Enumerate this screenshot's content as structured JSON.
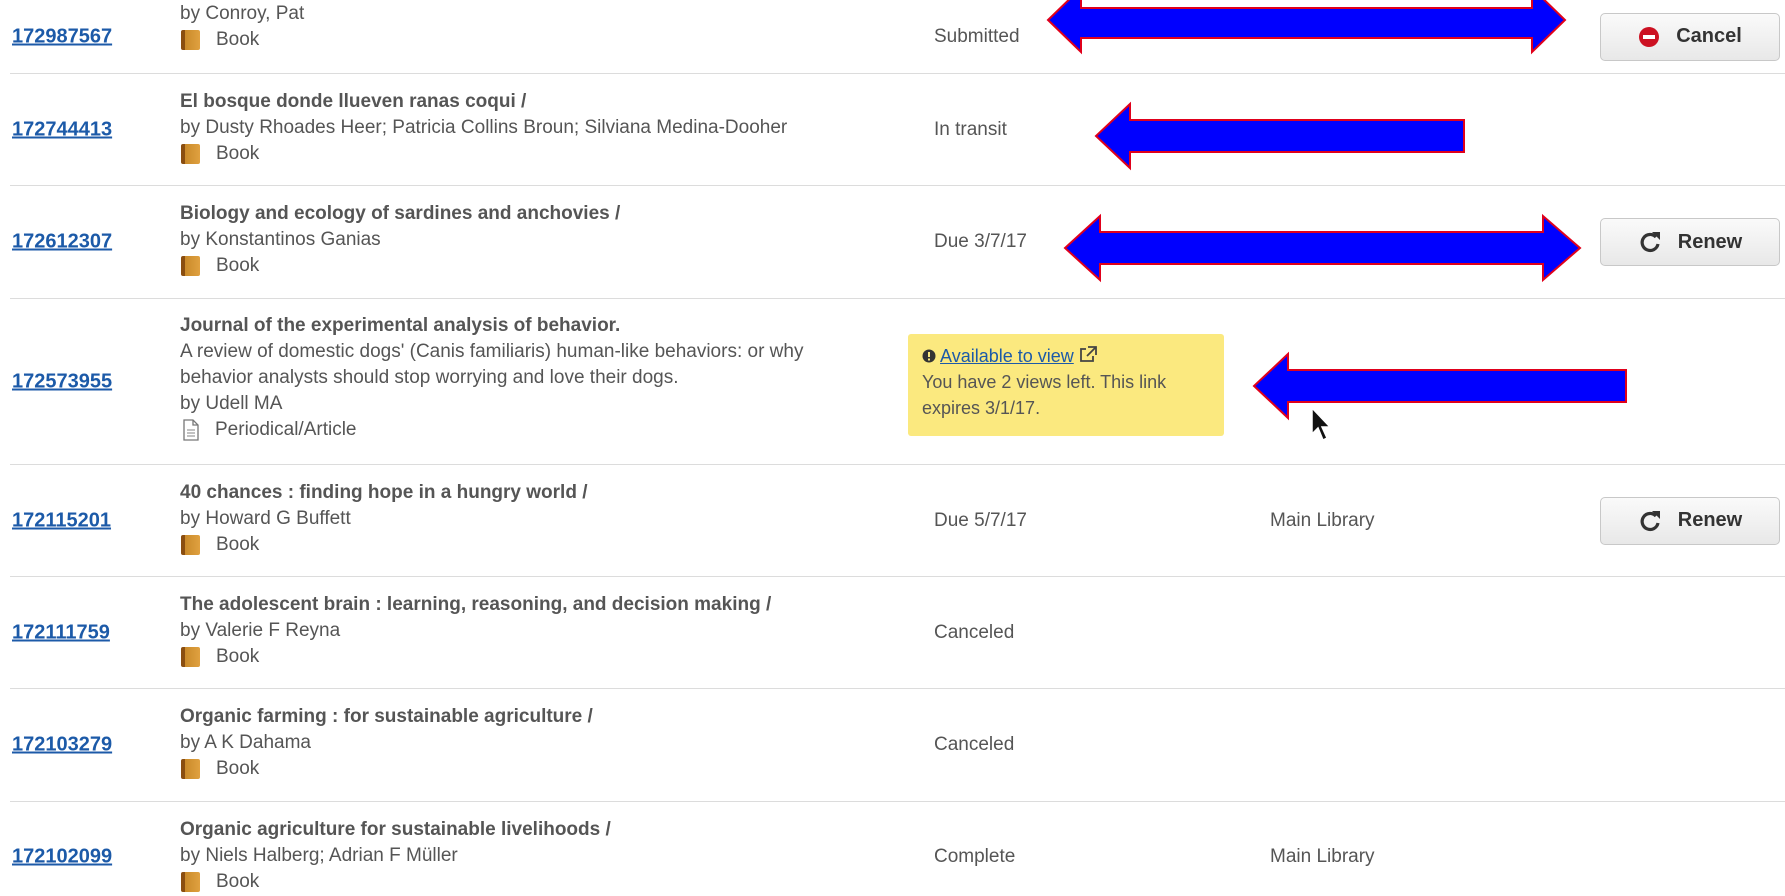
{
  "items": [
    {
      "id": "172987567",
      "title": "",
      "author": "by Conroy, Pat",
      "format": "Book",
      "status": "Submitted",
      "library": "",
      "action": "Cancel"
    },
    {
      "id": "172744413",
      "title": "El bosque donde llueven ranas coqui /",
      "author": "by Dusty Rhoades Heer; Patricia Collins Broun; Silviana Medina-Dooher",
      "format": "Book",
      "status": "In transit",
      "library": "",
      "action": ""
    },
    {
      "id": "172612307",
      "title": "Biology and ecology of sardines and anchovies /",
      "author": "by Konstantinos Ganias",
      "format": "Book",
      "status": "Due 3/7/17",
      "library": "",
      "action": "Renew"
    },
    {
      "id": "172573955",
      "title": "Journal of the experimental analysis of behavior.",
      "subtitle_line1": "A review of domestic dogs' (Canis familiaris) human-like behaviors: or why",
      "subtitle_line2": "behavior analysts should stop worrying and love their dogs.",
      "author": "by Udell MA",
      "format": "Periodical/Article",
      "status": "",
      "library": "",
      "action": ""
    },
    {
      "id": "172115201",
      "title": "40 chances : finding hope in a hungry world /",
      "author": "by Howard G Buffett",
      "format": "Book",
      "status": "Due 5/7/17",
      "library": "Main Library",
      "action": "Renew"
    },
    {
      "id": "172111759",
      "title": "The adolescent brain : learning, reasoning, and decision making /",
      "author": "by Valerie F Reyna",
      "format": "Book",
      "status": "Canceled",
      "library": "",
      "action": ""
    },
    {
      "id": "172103279",
      "title": "Organic farming : for sustainable agriculture /",
      "author": "by A K Dahama",
      "format": "Book",
      "status": "Canceled",
      "library": "",
      "action": ""
    },
    {
      "id": "172102099",
      "title": "Organic agriculture for sustainable livelihoods /",
      "author": "by Niels Halberg; Adrian F Müller",
      "format": "Book",
      "status": "Complete",
      "library": "Main Library",
      "action": ""
    }
  ],
  "notice": {
    "link_text": "Available to view",
    "line1": "You have 2 views left. This link",
    "line2": "expires 3/1/17."
  },
  "icons": {
    "book": "book-icon",
    "article": "document-icon",
    "cancel": "minus-circle-icon",
    "renew": "refresh-icon",
    "info": "exclamation-circle-icon",
    "external": "external-link-icon",
    "arrow": "blue-arrow-annotation",
    "cursor": "mouse-pointer-icon"
  },
  "colors": {
    "link": "#1c5aa8",
    "notice_bg": "#fbe97f",
    "arrow_fill": "#0000ff",
    "arrow_stroke": "#e0001b",
    "cancel_icon": "#cc1122"
  }
}
